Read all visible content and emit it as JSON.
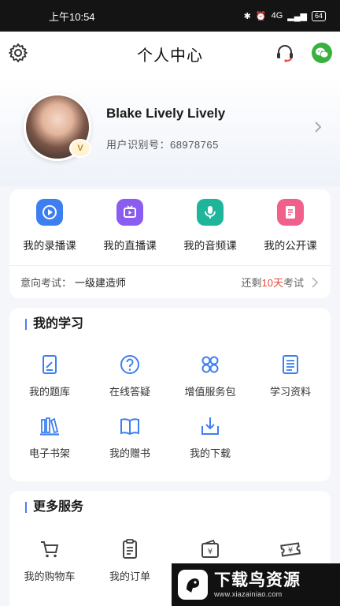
{
  "status_bar": {
    "time": "上午10:54",
    "network": "4G",
    "battery": "64"
  },
  "header": {
    "title": "个人中心"
  },
  "profile": {
    "name": "Blake Lively Lively",
    "id_label": "用户识别号：",
    "id_value": "68978765",
    "badge": "V"
  },
  "courses": [
    {
      "label": "我的录播课",
      "icon": "recorded-course-icon",
      "color": "#3d7ff0"
    },
    {
      "label": "我的直播课",
      "icon": "live-course-icon",
      "color": "#8a5cf0"
    },
    {
      "label": "我的音频课",
      "icon": "audio-course-icon",
      "color": "#1fb59a"
    },
    {
      "label": "我的公开课",
      "icon": "open-course-icon",
      "color": "#f0608a"
    }
  ],
  "exam": {
    "label": "意向考试：",
    "value": "一级建造师",
    "remain_prefix": "还剩",
    "remain_days": "10天",
    "remain_suffix": "考试"
  },
  "study": {
    "title": "我的学习",
    "items": [
      {
        "label": "我的题库",
        "icon": "question-bank-icon"
      },
      {
        "label": "在线答疑",
        "icon": "question-mark-icon"
      },
      {
        "label": "增值服务包",
        "icon": "service-pack-icon"
      },
      {
        "label": "学习资料",
        "icon": "document-icon"
      },
      {
        "label": "电子书架",
        "icon": "bookshelf-icon"
      },
      {
        "label": "我的赠书",
        "icon": "open-book-icon"
      },
      {
        "label": "我的下载",
        "icon": "download-icon"
      }
    ]
  },
  "more": {
    "title": "更多服务",
    "items": [
      {
        "label": "我的购物车",
        "icon": "cart-icon"
      },
      {
        "label": "我的订单",
        "icon": "order-icon"
      },
      {
        "label": "",
        "icon": "wallet-icon"
      },
      {
        "label": "",
        "icon": "coupon-icon"
      }
    ]
  },
  "watermark": {
    "title": "下载鸟资源",
    "url": "www.xiazainiao.com"
  },
  "colors": {
    "accent": "#4d7ee8",
    "highlight": "#e84a3b",
    "wechat": "#38b13e"
  }
}
